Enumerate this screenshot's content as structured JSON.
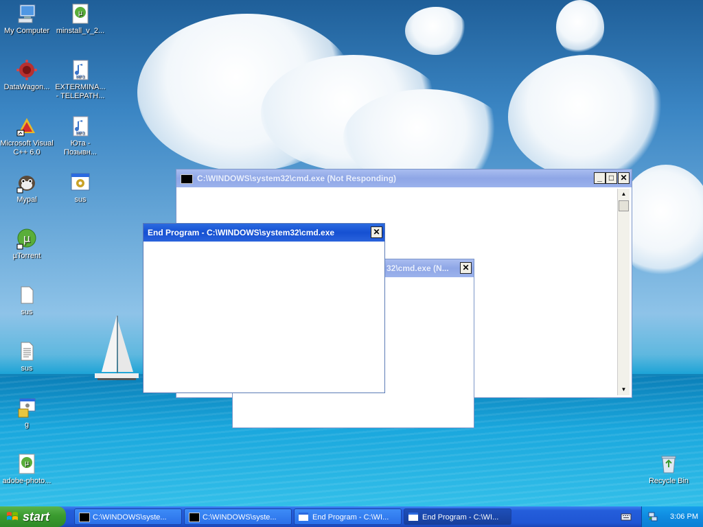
{
  "desktop": {
    "icons": [
      {
        "label": "My Computer",
        "icon": "computer-icon"
      },
      {
        "label": "minstall_v_2...",
        "icon": "utorrent-file-icon"
      },
      {
        "label": "DataWagon...",
        "icon": "datawagon-icon"
      },
      {
        "label": "EXTERMINA...\n- TELEPATH...",
        "icon": "mp3-file-icon"
      },
      {
        "label": "Microsoft Visual\nC++ 6.0",
        "icon": "visual-cpp-icon"
      },
      {
        "label": "Юта -\nПозывн...",
        "icon": "mp3-file-icon"
      },
      {
        "label": "Mypal",
        "icon": "mypal-icon"
      },
      {
        "label": "sus",
        "icon": "exe-gear-icon"
      },
      {
        "label": "µTorrent",
        "icon": "utorrent-icon"
      },
      {
        "label": "sus",
        "icon": "blank-file-icon"
      },
      {
        "label": "sus",
        "icon": "text-file-icon"
      },
      {
        "label": "g",
        "icon": "batch-file-icon"
      },
      {
        "label": "adobe-photo...",
        "icon": "utorrent-file-icon"
      },
      {
        "label": "Recycle Bin",
        "icon": "recycle-bin-icon"
      }
    ]
  },
  "windows": {
    "cmd_main": {
      "title": "C:\\WINDOWS\\system32\\cmd.exe (Not Responding)"
    },
    "cmd_back": {
      "title": "32\\cmd.exe (N..."
    },
    "end_program": {
      "title": "End Program - C:\\WINDOWS\\system32\\cmd.exe"
    }
  },
  "taskbar": {
    "start_label": "start",
    "tasks": [
      {
        "label": "C:\\WINDOWS\\syste...",
        "icon": "cmd-icon"
      },
      {
        "label": "C:\\WINDOWS\\syste...",
        "icon": "cmd-icon"
      },
      {
        "label": "End Program - C:\\WI...",
        "icon": "window-icon"
      },
      {
        "label": "End Program - C:\\WI...",
        "icon": "window-icon"
      }
    ],
    "clock": "3:06 PM"
  },
  "colors": {
    "taskbar": "#245edb",
    "start_button": "#3a9b2f",
    "active_title": "#1550d2",
    "inactive_title": "#9bb2ec"
  }
}
